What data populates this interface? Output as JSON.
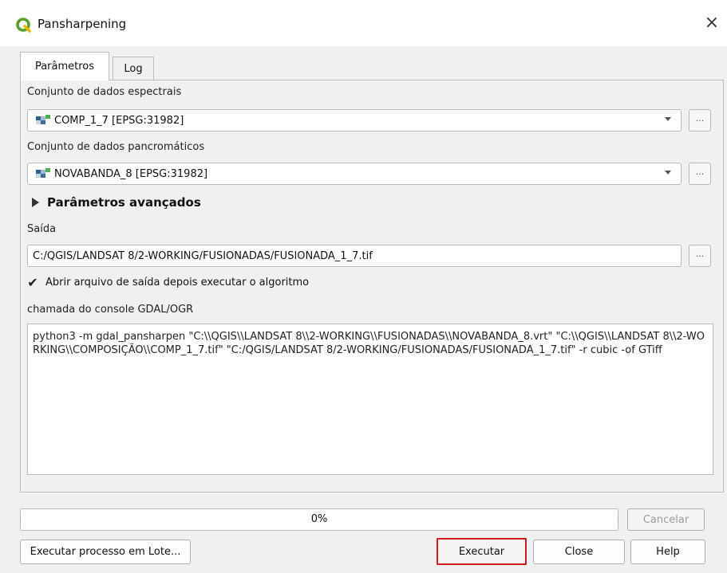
{
  "window": {
    "title": "Pansharpening"
  },
  "tabs": [
    {
      "label": "Parâmetros",
      "active": true
    },
    {
      "label": "Log",
      "active": false
    }
  ],
  "params": {
    "spectral_label": "Conjunto de dados espectrais",
    "spectral_value": "COMP_1_7 [EPSG:31982]",
    "panchromatic_label": "Conjunto de dados pancromáticos",
    "panchromatic_value": "NOVABANDA_8 [EPSG:31982]",
    "advanced_label": "Parâmetros avançados",
    "output_label": "Saída",
    "output_value": "C:/QGIS/LANDSAT 8/2-WORKING/FUSIONADAS/FUSIONADA_1_7.tif",
    "browse_label": "...",
    "open_output_label": "Abrir arquivo de saída depois executar o algoritmo",
    "open_output_checked": true,
    "console_label": "chamada do console GDAL/OGR",
    "console_text": "python3 -m gdal_pansharpen \"C:\\\\QGIS\\\\LANDSAT 8\\\\2-WORKING\\\\FUSIONADAS\\\\NOVABANDA_8.vrt\" \"C:\\\\QGIS\\\\LANDSAT 8\\\\2-WORKING\\\\COMPOSIÇÃO\\\\COMP_1_7.tif\" \"C:/QGIS/LANDSAT 8/2-WORKING/FUSIONADAS/FUSIONADA_1_7.tif\" -r cubic -of GTiff"
  },
  "footer": {
    "progress_text": "0%",
    "progress_value": 0,
    "cancel_label": "Cancelar",
    "batch_label": "Executar processo em Lote...",
    "run_label": "Executar",
    "close_label": "Close",
    "help_label": "Help"
  },
  "colors": {
    "accent_highlight": "#d11919",
    "qgis_green": "#5a9e2f"
  },
  "icons": {
    "app": "qgis-logo-icon",
    "raster": "raster-layer-icon",
    "close": "close-icon"
  }
}
